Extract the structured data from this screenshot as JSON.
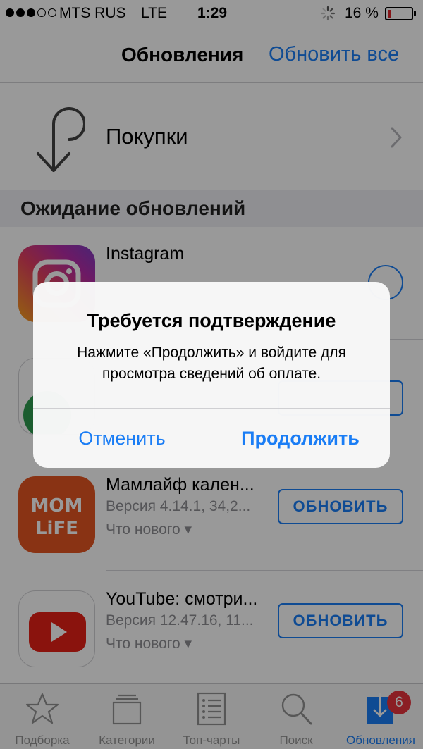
{
  "status_bar": {
    "carrier": "MTS RUS",
    "network": "LTE",
    "time": "1:29",
    "battery_percent": "16 %",
    "battery_color": "#e0262a"
  },
  "nav": {
    "title": "Обновления",
    "action_label": "Обновить все"
  },
  "purchases": {
    "label": "Покупки",
    "icon": "purchases-arrow-icon"
  },
  "section": {
    "title": "Ожидание обновлений"
  },
  "apps": [
    {
      "name": "Instagram",
      "icon": "instagram-icon",
      "state": "downloading"
    },
    {
      "icon": "app-icon",
      "button": ""
    },
    {
      "name": "Мамлайф кален...",
      "icon": "momlife-icon",
      "icon_text_1": "MOM",
      "icon_text_2": "LiFE",
      "meta": "Версия 4.14.1, 34,2...",
      "whats_new": "Что нового ▾",
      "button": "ОБНОВИТЬ"
    },
    {
      "name": "YouTube: смотри...",
      "icon": "youtube-icon",
      "meta": "Версия 12.47.16, 11...",
      "whats_new": "Что нового ▾",
      "button": "ОБНОВИТЬ"
    }
  ],
  "tabs": [
    {
      "label": "Подборка",
      "icon": "star-icon"
    },
    {
      "label": "Категории",
      "icon": "categories-icon"
    },
    {
      "label": "Топ-чарты",
      "icon": "top-charts-icon"
    },
    {
      "label": "Поиск",
      "icon": "search-icon"
    },
    {
      "label": "Обновления",
      "icon": "updates-icon",
      "active": true,
      "badge": "6"
    }
  ],
  "alert": {
    "title": "Требуется подтверждение",
    "message": "Нажмите «Продолжить» и войдите для просмотра сведений об оплате.",
    "cancel_label": "Отменить",
    "continue_label": "Продолжить"
  },
  "colors": {
    "accent": "#1a7df5",
    "badge": "#e8333c"
  }
}
